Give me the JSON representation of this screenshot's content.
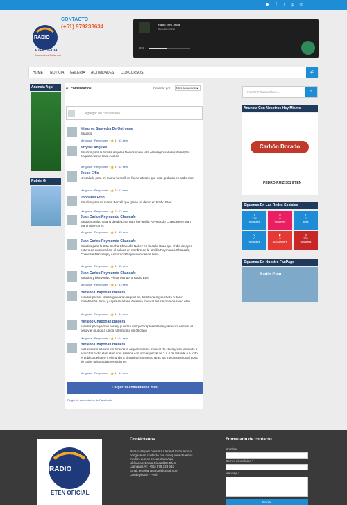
{
  "header": {
    "contact_title": "CONTACTO",
    "phone": "(+51) 979233634"
  },
  "top_icons": [
    "youtube-icon",
    "facebook-icon",
    "twitter-icon",
    "pinterest-icon",
    "instagram-icon"
  ],
  "player": {
    "title": "Radio Eten Oficial",
    "subtitle": "Radio Eten Oficial",
    "time": "00:00",
    "progress": 0.45
  },
  "nav": {
    "items": [
      "HOME",
      "NOTICIA",
      "GALERÍA",
      "ACTIVIDADES",
      "CONCURSOS"
    ]
  },
  "sidebar_left": {
    "ad_title": "Anuncia Aquí",
    "ruben_title": "Rubén G"
  },
  "comments": {
    "count": "41 comentarios",
    "order_label": "Ordenar por",
    "order_value": "Más recientes ▾",
    "placeholder": "Agregar un comentario...",
    "list": [
      {
        "name": "Milagros Saavedra De Quiroque",
        "text": "Saludos",
        "meta": "Me gusta · Responder · 👍 1 · 12 sem"
      },
      {
        "name": "Krrytos Angeles",
        "text": "Saludos para la familia Angeles Necioslup en villa el milagro saludos de krrytos Angeles desde lima -comas",
        "meta": "Me gusta · Responder · 👍 1 · 12 sem"
      },
      {
        "name": "Jesus Effio",
        "text": "Un saludo para mi mama bercelli un fuerte abrazo que esta grabado en radio eten",
        "meta": "Me gusta · Responder · 👍 2 · 13 sem"
      },
      {
        "name": "Jhonatan Effio",
        "text": "Saludos para mi mamá Berzeli que grabó un demo en Radio Eten",
        "meta": "Me gusta · Responder · 👍 2 · 13 sem"
      },
      {
        "name": "Juan Carlos Reymundo Chancafe",
        "text": "Saludos amigo Gitano desde Lima para la Familia Reymundo Chancafe en San Martín de Porres",
        "meta": "Me gusta · Responder · 👍 1 · 13 sem"
      },
      {
        "name": "Juan Carlos Reymundo Chancafe",
        "text": "Saludos para la Srta Bertha Chancafe Nañez en la calle Grau que el día de ayer estuvo de cumpleaños, el saludo en nombre de la familia Reymundo Chancafe, Chancafe Neciosup y Asmoracid Reymundo desde Lima",
        "meta": "Me gusta · Responder · 👍 1 · 13 sem"
      },
      {
        "name": "Juan Carlos Reymundo Chancafe",
        "text": "Saludos y bienvenido Víctor Manuel a Radio Eten",
        "meta": "Me gusta · Responder · 👍 1 · 13 sem"
      },
      {
        "name": "Heraldo Chaponan Baldera",
        "text": "saludos para la familia guevara vasquez en distrito de lagua chota cutervo mollebamba llama y cajamarca fans de salsa musical full sintonía de radio eten",
        "meta": "Me gusta · Responder · 👍 1 · 14 sem"
      },
      {
        "name": "Heraldo Chaponan Baldera",
        "text": "saludos para yazmin roselly guevara vasquez representante y asesora en todo el perú y el mundo a unica full sintonía en chiclayo",
        "meta": "Me gusta · Responder · 👍 1 · 14 sem"
      },
      {
        "name": "Heraldo Chaponan Baldera",
        "text": "hola saludos a todos los fans de la orquesta salsa musical de chiclayo se les invita a escuchar radio eten eten aquí salimos con otro especial de 3 a 4 de la tarde y a todo el publico del peru y el mundo a sintonizarnos escucharas los mejores exitos al gusto de todos uds gracias vendiciones",
        "meta": "Me gusta · Responder · 👍 1 · 14 sem"
      }
    ],
    "load_more": "Cargar 10 comentarios más",
    "plugin": "Plugin de comentarios de Facebook"
  },
  "sidebar_right": {
    "search_placeholder": "Inserte Palabra Clave...",
    "ads_title": "Anuncia Con Nosotros Hoy Mismo",
    "carbon_title": "Carbón Dorado",
    "carbon_address": "PEDRO RUIZ 301 ETEN",
    "social_title": "Siguenos En Las Redes Sociales",
    "social": [
      {
        "icon": "twitter-icon",
        "count": "114",
        "label": "followers"
      },
      {
        "icon": "pinterest-icon",
        "count": "0",
        "label": "followers"
      },
      {
        "icon": "facebook-icon",
        "count": "0",
        "label": "likes"
      },
      {
        "icon": "vimeo-icon",
        "count": "0",
        "label": "followers"
      },
      {
        "icon": "youtube-icon",
        "count": "0",
        "label": "subscribers"
      },
      {
        "icon": "instagram-icon",
        "count": "266",
        "label": "followers"
      }
    ],
    "fanpage_title": "Siguenos En Nuestro FanPage",
    "fanpage_name": "Radio Eten"
  },
  "footer": {
    "contact_title": "Contáctanos",
    "contact_text": "Para cualquier consulta Llene el formulario o póngase en contacto con cualquiera de estos medios que se encuentran Aquí",
    "ubicanos": "Ubícanos: En La Ciudad De Eten",
    "llamanos": "Llámanos Al: (+51) 979 233 634",
    "email": "Email: estebanucardal@gmail.com",
    "lugar": "Lambayeque - Perú",
    "form_title": "Formulario de contacto",
    "name_label": "Nombre",
    "email_label": "Correo electrónico *",
    "message_label": "Mensaje *",
    "send_label": "Enviar"
  }
}
